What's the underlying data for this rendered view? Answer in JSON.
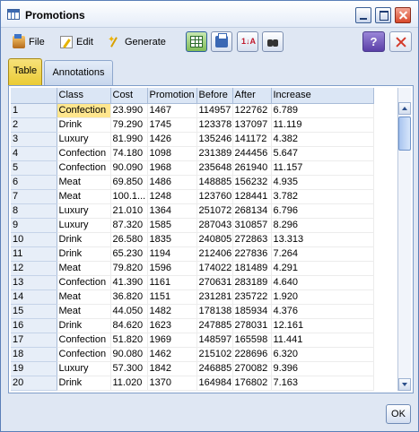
{
  "window": {
    "title": "Promotions"
  },
  "menu": {
    "file": "File",
    "edit": "Edit",
    "generate": "Generate"
  },
  "toolbar": {
    "help_label": "?"
  },
  "tabs": [
    {
      "label": "Table"
    },
    {
      "label": "Annotations"
    }
  ],
  "table": {
    "columns": [
      "",
      "Class",
      "Cost",
      "Promotion",
      "Before",
      "After",
      "Increase"
    ],
    "rows": [
      [
        "1",
        "Confection",
        "23.990",
        "1467",
        "114957",
        "122762",
        "6.789"
      ],
      [
        "2",
        "Drink",
        "79.290",
        "1745",
        "123378",
        "137097",
        "11.119"
      ],
      [
        "3",
        "Luxury",
        "81.990",
        "1426",
        "135246",
        "141172",
        "4.382"
      ],
      [
        "4",
        "Confection",
        "74.180",
        "1098",
        "231389",
        "244456",
        "5.647"
      ],
      [
        "5",
        "Confection",
        "90.090",
        "1968",
        "235648",
        "261940",
        "11.157"
      ],
      [
        "6",
        "Meat",
        "69.850",
        "1486",
        "148885",
        "156232",
        "4.935"
      ],
      [
        "7",
        "Meat",
        "100.1...",
        "1248",
        "123760",
        "128441",
        "3.782"
      ],
      [
        "8",
        "Luxury",
        "21.010",
        "1364",
        "251072",
        "268134",
        "6.796"
      ],
      [
        "9",
        "Luxury",
        "87.320",
        "1585",
        "287043",
        "310857",
        "8.296"
      ],
      [
        "10",
        "Drink",
        "26.580",
        "1835",
        "240805",
        "272863",
        "13.313"
      ],
      [
        "11",
        "Drink",
        "65.230",
        "1194",
        "212406",
        "227836",
        "7.264"
      ],
      [
        "12",
        "Meat",
        "79.820",
        "1596",
        "174022",
        "181489",
        "4.291"
      ],
      [
        "13",
        "Confection",
        "41.390",
        "1161",
        "270631",
        "283189",
        "4.640"
      ],
      [
        "14",
        "Meat",
        "36.820",
        "1151",
        "231281",
        "235722",
        "1.920"
      ],
      [
        "15",
        "Meat",
        "44.050",
        "1482",
        "178138",
        "185934",
        "4.376"
      ],
      [
        "16",
        "Drink",
        "84.620",
        "1623",
        "247885",
        "278031",
        "12.161"
      ],
      [
        "17",
        "Confection",
        "51.820",
        "1969",
        "148597",
        "165598",
        "11.441"
      ],
      [
        "18",
        "Confection",
        "90.080",
        "1462",
        "215102",
        "228696",
        "6.320"
      ],
      [
        "19",
        "Luxury",
        "57.300",
        "1842",
        "246885",
        "270082",
        "9.396"
      ],
      [
        "20",
        "Drink",
        "11.020",
        "1370",
        "164984",
        "176802",
        "7.163"
      ]
    ]
  },
  "footer": {
    "ok_label": "OK"
  },
  "colors": {
    "selected_cell": "#ffe68e",
    "header_bg": "#dbe6f5",
    "active_tab": "#eacb34"
  }
}
